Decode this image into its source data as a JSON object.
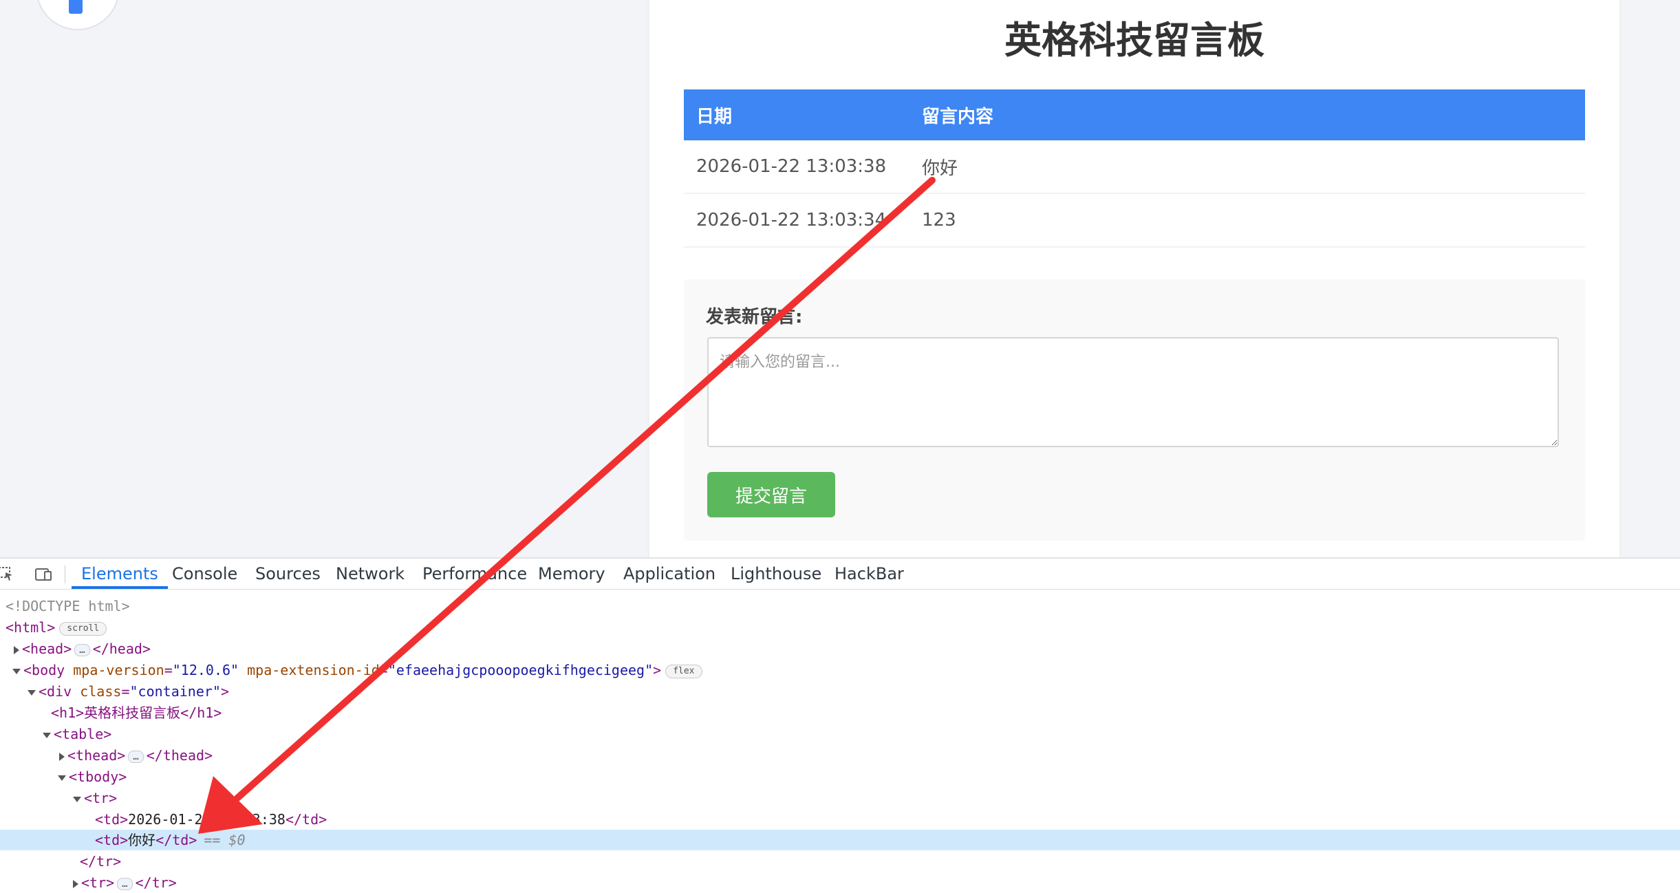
{
  "page": {
    "title": "英格科技留言板",
    "table": {
      "headers": [
        "日期",
        "留言内容"
      ],
      "rows": [
        {
          "date": "2026-01-22 13:03:38",
          "content": "你好"
        },
        {
          "date": "2026-01-22 13:03:34",
          "content": "123"
        }
      ]
    },
    "form": {
      "label": "发表新留言:",
      "placeholder": "请输入您的留言...",
      "submit_label": "提交留言"
    }
  },
  "devtools": {
    "tabs": [
      "Elements",
      "Console",
      "Sources",
      "Network",
      "Performance",
      "Memory",
      "Application",
      "Lighthouse",
      "HackBar"
    ],
    "active_tab": "Elements",
    "dom": {
      "doctype": "<!DOCTYPE html>",
      "html_open": "<html>",
      "html_badge": "scroll",
      "head_open": "<head>",
      "head_close": "</head>",
      "body_open": "<body ",
      "body_attr1": "mpa-version",
      "body_val1": "\"12.0.6\"",
      "body_attr2": "mpa-extension-id",
      "body_val2": "\"efaeehajgcpooopoegkifhgecigeeg\"",
      "body_close_bracket": ">",
      "body_badge": "flex",
      "div_open": "<div ",
      "div_attr": "class",
      "div_val": "\"container\"",
      "div_close_bracket": ">",
      "h1_line": "<h1>英格科技留言板</h1>",
      "table_open": "<table>",
      "thead_open": "<thead>",
      "thead_close": "</thead>",
      "tbody_open": "<tbody>",
      "tr_open": "<tr>",
      "td_date_open": "<td>",
      "td_date_text": "2026-01-22 13:03:38",
      "td_close": "</td>",
      "td_sel_open": "<td>",
      "td_sel_text": "你好",
      "td_sel_close": "</td>",
      "selected_marker": "== $0",
      "tr_close": "</tr>",
      "tr2_open": "<tr>",
      "tr2_close": "</tr>",
      "ellipsis": "…"
    }
  },
  "annotation": {
    "arrow_color": "#f03030"
  }
}
